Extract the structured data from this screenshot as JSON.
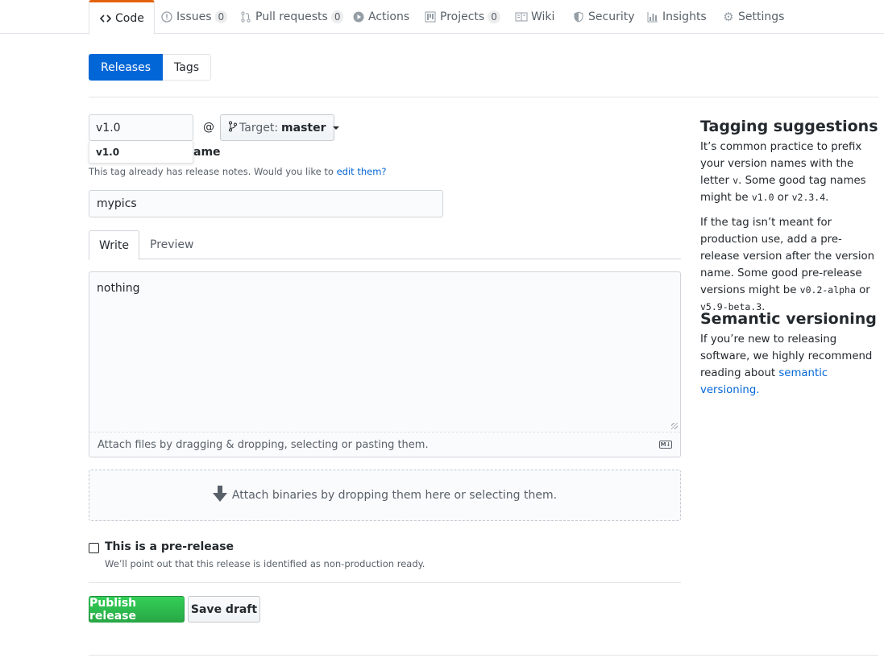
{
  "nav": {
    "code": "Code",
    "issues": "Issues",
    "issues_count": "0",
    "pulls": "Pull requests",
    "pulls_count": "0",
    "actions": "Actions",
    "projects": "Projects",
    "projects_count": "0",
    "wiki": "Wiki",
    "security": "Security",
    "insights": "Insights",
    "settings": "Settings"
  },
  "subnav": {
    "releases": "Releases",
    "tags": "Tags"
  },
  "form": {
    "tag_value": "v1.0",
    "at": "@",
    "target_label": "Target:",
    "target_branch": "master",
    "suggestion": "v1.0",
    "heading_partial": "ame",
    "note_text": "This tag already has release notes. Would you like to",
    "note_link": "edit them?",
    "title_value": "mypics",
    "tab_write": "Write",
    "tab_preview": "Preview",
    "body_value": "nothing",
    "attach_hint": "Attach files by dragging & dropping, selecting or pasting them.",
    "md_badge": "M↓",
    "dropzone_text": "Attach binaries by dropping them here or selecting them.",
    "prerelease_label": "This is a pre-release",
    "prerelease_note": "We’ll point out that this release is identified as non-production ready.",
    "prerelease_checked": false,
    "publish": "Publish release",
    "save_draft": "Save draft"
  },
  "sidebar": {
    "tagging_title": "Tagging suggestions",
    "tagging_p1_a": "It’s common practice to prefix your version names with the letter",
    "tagging_p1_v": "v",
    "tagging_p1_b": ". Some good tag names might be",
    "tagging_p1_code1": "v1.0",
    "tagging_p1_or": "or",
    "tagging_p1_code2": "v2.3.4",
    "tagging_p2_a": "If the tag isn’t meant for production use, add a pre-release version after the version name. Some good pre-release versions might be",
    "tagging_p2_code1": "v0.2-alpha",
    "tagging_p2_or": "or",
    "tagging_p2_code2": "v5.9-beta.3",
    "semver_title": "Semantic versioning",
    "semver_p_a": "If you’re new to releasing software, we highly recommend reading about",
    "semver_link": "semantic versioning."
  },
  "colors": {
    "accent_blue": "#0366d6",
    "publish_green": "#28a745",
    "nav_active_border": "#e36209"
  }
}
